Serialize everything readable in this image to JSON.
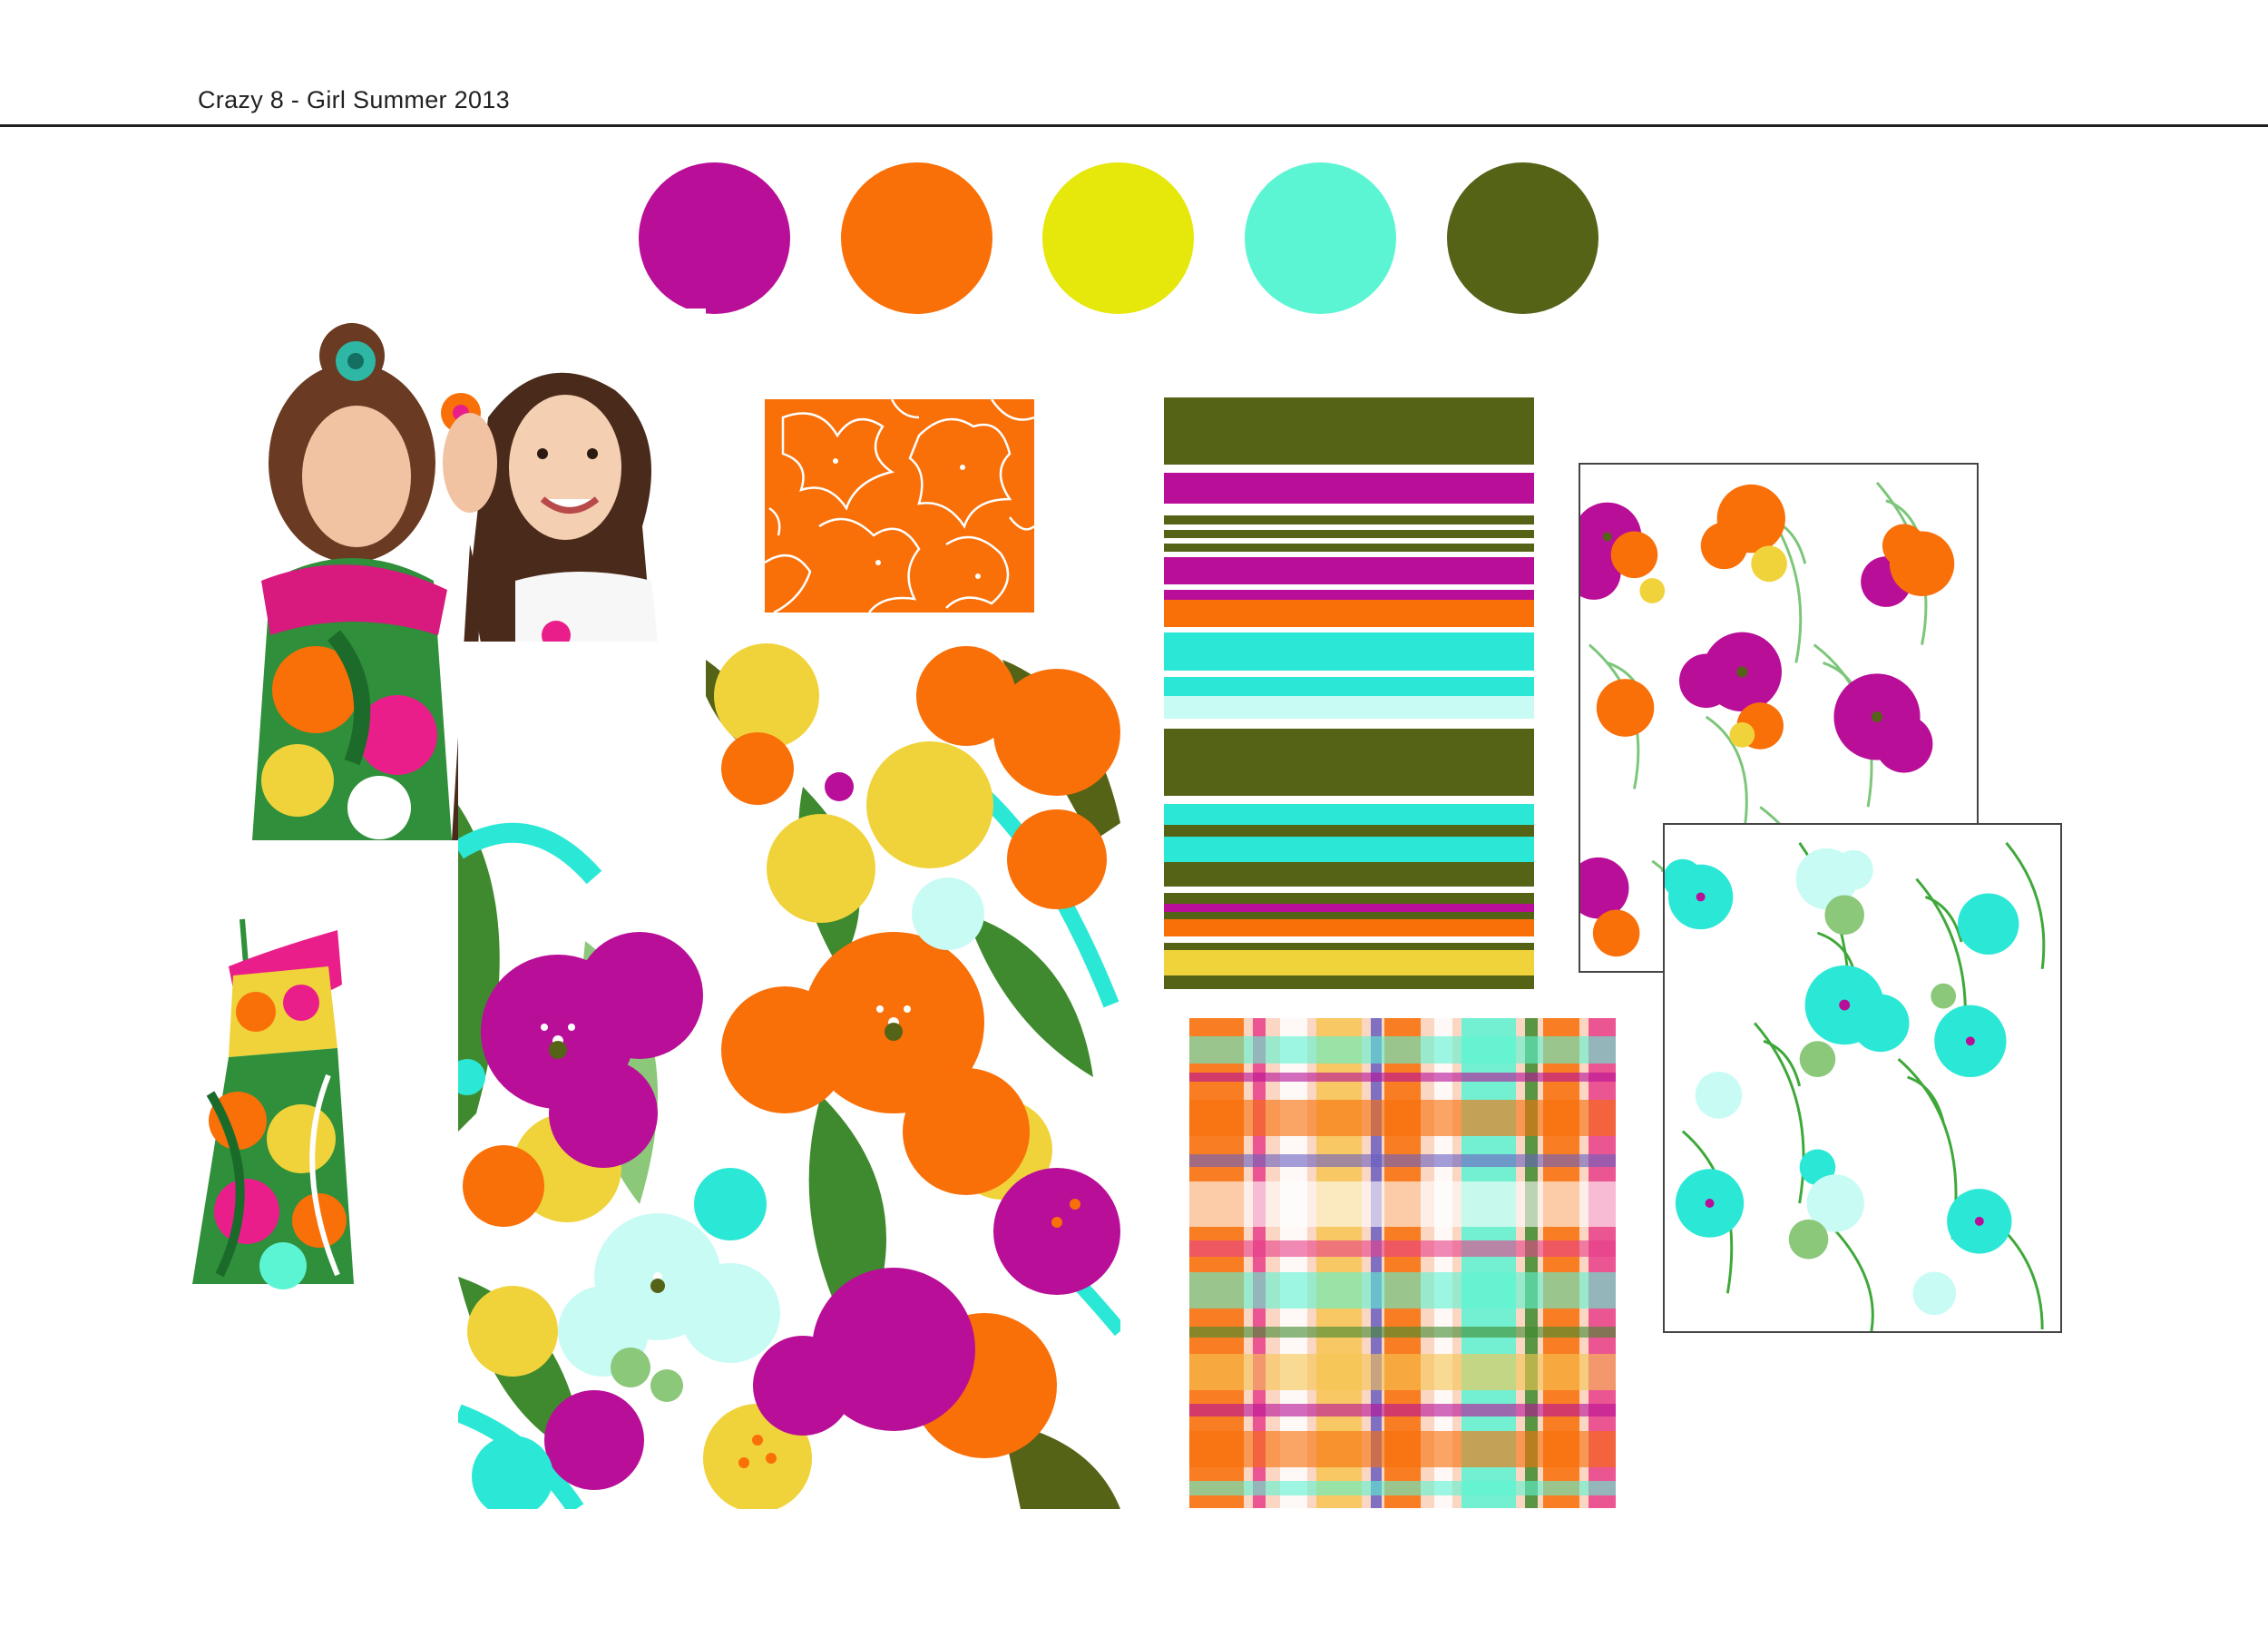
{
  "header": {
    "title": "Crazy 8 - Girl Summer 2013"
  },
  "palette": {
    "colors": [
      "#b80e98",
      "#f96f08",
      "#e6e70a",
      "#5cf5d4",
      "#556317"
    ]
  },
  "images": {
    "photo_girls": "two-girls-whispering-photo",
    "photo_dress": "floral-sundress-photo",
    "print_large": "large-tropical-floral-print",
    "print_orange": "orange-line-floral-print",
    "print_stripe": "multicolor-stripe-print",
    "print_plaid": "bright-madras-plaid-print",
    "print_floral_orange": "magenta-orange-floral-leaf-print",
    "print_floral_aqua": "aqua-floral-leaf-print"
  },
  "stripes": [
    {
      "color": "#556317",
      "h": 70
    },
    {
      "color": "#ffffff",
      "h": 8
    },
    {
      "color": "#b80e98",
      "h": 32
    },
    {
      "color": "#ffffff",
      "h": 12
    },
    {
      "color": "#556317",
      "h": 10
    },
    {
      "color": "#ffffff",
      "h": 6
    },
    {
      "color": "#556317",
      "h": 8
    },
    {
      "color": "#ffffff",
      "h": 6
    },
    {
      "color": "#556317",
      "h": 8
    },
    {
      "color": "#ffffff",
      "h": 6
    },
    {
      "color": "#b80e98",
      "h": 28
    },
    {
      "color": "#ffffff",
      "h": 6
    },
    {
      "color": "#b80e98",
      "h": 10
    },
    {
      "color": "#f96f08",
      "h": 28
    },
    {
      "color": "#ffffff",
      "h": 6
    },
    {
      "color": "#2be8d6",
      "h": 40
    },
    {
      "color": "#ffffff",
      "h": 6
    },
    {
      "color": "#2be8d6",
      "h": 20
    },
    {
      "color": "#c9fbf5",
      "h": 24
    },
    {
      "color": "#ffffff",
      "h": 10
    },
    {
      "color": "#556317",
      "h": 70
    },
    {
      "color": "#ffffff",
      "h": 8
    },
    {
      "color": "#2be8d6",
      "h": 22
    },
    {
      "color": "#556317",
      "h": 12
    },
    {
      "color": "#2be8d6",
      "h": 26
    },
    {
      "color": "#556317",
      "h": 26
    },
    {
      "color": "#ffffff",
      "h": 6
    },
    {
      "color": "#556317",
      "h": 12
    },
    {
      "color": "#b80e98",
      "h": 8
    },
    {
      "color": "#556317",
      "h": 8
    },
    {
      "color": "#f96f08",
      "h": 18
    },
    {
      "color": "#ffffff",
      "h": 6
    },
    {
      "color": "#556317",
      "h": 8
    },
    {
      "color": "#f0d33a",
      "h": 26
    },
    {
      "color": "#556317",
      "h": 14
    }
  ]
}
